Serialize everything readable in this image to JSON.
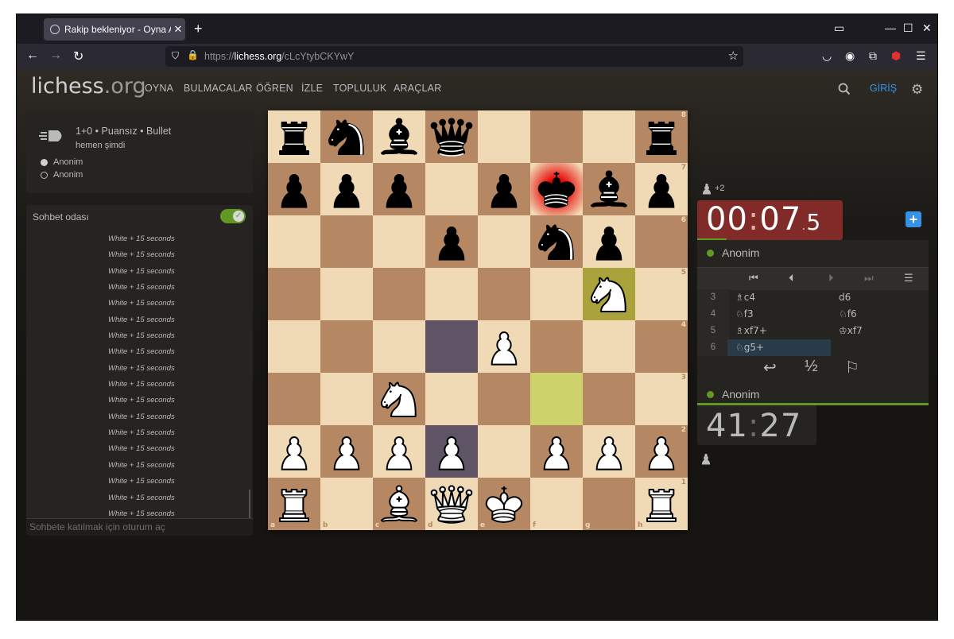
{
  "browser": {
    "tab_title": "Rakip bekleniyor - Oyna Ar",
    "url_prefix": "https://",
    "url_domain": "lichess.org",
    "url_path": "/cLcYtybCKYwY"
  },
  "site": {
    "logo_main": "lichess",
    "logo_tld": ".org",
    "menu": [
      "OYNA",
      "BULMACALAR",
      "ÖĞREN",
      "İZLE",
      "TOPLULUK",
      "ARAÇLAR"
    ],
    "login_label": "GİRİŞ"
  },
  "game_info": {
    "title": "1+0 • Puansız • Bullet",
    "time": "hemen şimdi",
    "players": [
      "Anonim",
      "Anonim"
    ]
  },
  "chat": {
    "title": "Sohbet odası",
    "messages": [
      "White + 15 seconds",
      "White + 15 seconds",
      "White + 15 seconds",
      "White + 15 seconds",
      "White + 15 seconds",
      "White + 15 seconds",
      "White + 15 seconds",
      "White + 15 seconds",
      "White + 15 seconds",
      "White + 15 seconds",
      "White + 15 seconds",
      "White + 15 seconds",
      "White + 15 seconds",
      "White + 15 seconds",
      "White + 15 seconds",
      "White + 15 seconds",
      "White + 15 seconds",
      "White + 15 seconds"
    ],
    "input_placeholder": "Sohbete katılmak için oturum aç"
  },
  "board": {
    "ranks_top_down": [
      "8",
      "7",
      "6",
      "5",
      "4",
      "3",
      "2",
      "1"
    ],
    "files": [
      "a",
      "b",
      "c",
      "d",
      "e",
      "f",
      "g",
      "h"
    ],
    "position": [
      [
        "br",
        "bn",
        "bb",
        "bq",
        "",
        "",
        "",
        "br"
      ],
      [
        "bp",
        "bp",
        "bp",
        "",
        "bp",
        "bk",
        "bb",
        "bp"
      ],
      [
        "",
        "",
        "",
        "bp",
        "",
        "bn",
        "bp",
        ""
      ],
      [
        "",
        "",
        "",
        "",
        "",
        "",
        "wn",
        ""
      ],
      [
        "",
        "",
        "",
        "",
        "wp",
        "",
        "",
        ""
      ],
      [
        "",
        "",
        "wn",
        "",
        "",
        "",
        "",
        ""
      ],
      [
        "wp",
        "wp",
        "wp",
        "wp",
        "",
        "wp",
        "wp",
        "wp"
      ],
      [
        "wr",
        "",
        "wb",
        "wq",
        "wk",
        "",
        "",
        "wr"
      ]
    ],
    "colors": {
      "light": "#f0d9b5",
      "dark": "#b58863",
      "last_move": "#aaa23a",
      "last_move_light": "#cdd26a",
      "premove": "#5e5466"
    }
  },
  "right_panel": {
    "captured_diff": "+2",
    "top_clock": {
      "min": "00",
      "sec": "07",
      "tenths": "5"
    },
    "top_player": "Anonim",
    "moves": [
      {
        "n": "3",
        "w": "♗c4",
        "b": "d6"
      },
      {
        "n": "4",
        "w": "♘f3",
        "b": "♘f6"
      },
      {
        "n": "5",
        "w": "♗xf7+",
        "b": "♔xf7"
      },
      {
        "n": "6",
        "w": "♘g5+",
        "b": ""
      }
    ],
    "half_label": "½",
    "bottom_player": "Anonim",
    "bottom_clock": {
      "min": "41",
      "sec": "27"
    }
  }
}
